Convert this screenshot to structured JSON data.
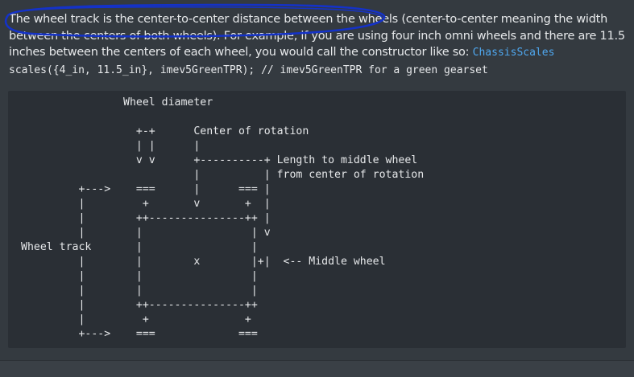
{
  "paragraph": {
    "text_part1": "The wheel track is the center-to-center distance between the wheels (center-to-center meaning the width between the centers of both wheels). For example, if you are using four inch omni wheels and there are 11.5 inches between the centers of each wheel, you would call the constructor like so: ",
    "code_link": "ChassisScales",
    "code_part2": " scales({4_in, 11.5_in}, imev5GreenTPR); // imev5GreenTPR for a green gearset"
  },
  "diagram": {
    "ascii": "                Wheel diameter\n\n                  +-+      Center of rotation\n                  | |      |\n                  v v      +----------+ Length to middle wheel\n                           |          | from center of rotation\n         +--->    ===      |      === |\n         |         +       v       +  |\n         |        ++---------------++ |\n         |        |                 | v\nWheel track       |                 |\n         |        |        x        |+|  <-- Middle wheel\n         |        |                 |\n         |        |                 |\n         |        ++---------------++\n         |         +               +\n         +--->    ===             ==="
  },
  "colors": {
    "page_bg": "#343a40",
    "code_block_bg": "#2a2f35",
    "text": "#e6e8ea",
    "link": "#4fa8f0",
    "annotation": "#1432c8"
  }
}
